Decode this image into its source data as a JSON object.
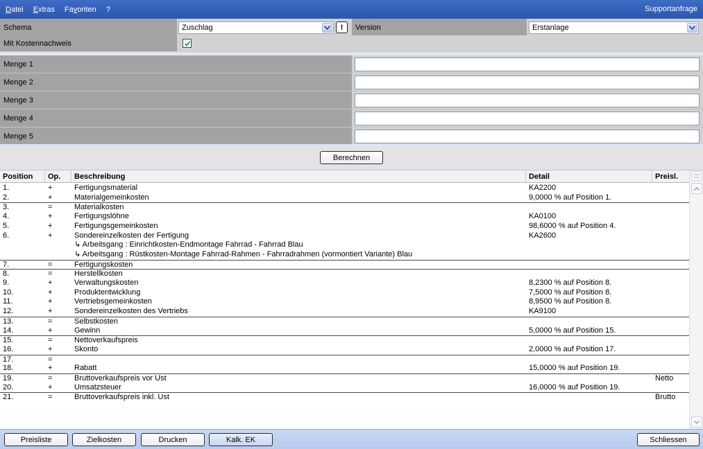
{
  "menu": {
    "items": [
      "Datei",
      "Extras",
      "Favoriten",
      "?"
    ],
    "underline": [
      "D",
      "E",
      "v",
      ""
    ],
    "support": "Supportanfrage"
  },
  "form": {
    "schema_label": "Schema",
    "schema_value": "Zuschlag",
    "warn_symbol": "!",
    "version_label": "Version",
    "version_value": "Erstanlage",
    "kostennachweis_label": "Mit Kostennachweis",
    "kostennachweis_checked": true,
    "mengen": [
      "Menge 1",
      "Menge 2",
      "Menge 3",
      "Menge 4",
      "Menge 5"
    ],
    "berechnen": "Berechnen"
  },
  "table": {
    "headers": [
      "Position",
      "Op.",
      "Beschreibung",
      "Detail",
      "Preisl."
    ],
    "rows": [
      {
        "pos": "1.",
        "op": "+",
        "desc": "Fertigungsmaterial",
        "detail": "KA2200",
        "preis": "",
        "sep": false
      },
      {
        "pos": "2.",
        "op": "+",
        "desc": "Materialgemeinkosten",
        "detail": "9,0000 % auf Position 1.",
        "preis": "",
        "sep": false
      },
      {
        "pos": "3.",
        "op": "=",
        "desc": "Materialkosten",
        "detail": "",
        "preis": "",
        "sep": true
      },
      {
        "pos": "4.",
        "op": "+",
        "desc": "Fertigungslöhne",
        "detail": "KA0100",
        "preis": "",
        "sep": false
      },
      {
        "pos": "5.",
        "op": "+",
        "desc": "Fertigungsgemeinkosten",
        "detail": "98,6000 % auf Position 4.",
        "preis": "",
        "sep": false
      },
      {
        "pos": "6.",
        "op": "+",
        "desc": "Sondereinzelkosten der Fertigung",
        "detail": "KA2600",
        "preis": "",
        "sep": false
      },
      {
        "pos": "",
        "op": "",
        "desc": "↳ Arbeitsgang : Einrichtkosten-Endmontage Fahrrad - Fahrrad Blau",
        "detail": "",
        "preis": "",
        "sep": false
      },
      {
        "pos": "",
        "op": "",
        "desc": "↳ Arbeitsgang : Rüstkosten-Montage Fahrrad-Rahmen - Fahrradrahmen (vormontiert Variante) Blau",
        "detail": "",
        "preis": "",
        "sep": false
      },
      {
        "pos": "7.",
        "op": "=",
        "desc": "Fertigungskosten",
        "detail": "",
        "preis": "",
        "sep": true
      },
      {
        "pos": "8.",
        "op": "=",
        "desc": "Herstellkosten",
        "detail": "",
        "preis": "",
        "sep": true
      },
      {
        "pos": "9.",
        "op": "+",
        "desc": "Verwaltungskosten",
        "detail": "8,2300 % auf Position 8.",
        "preis": "",
        "sep": false
      },
      {
        "pos": "10.",
        "op": "+",
        "desc": "Produktentwicklung",
        "detail": "7,5000 % auf Position 8.",
        "preis": "",
        "sep": false
      },
      {
        "pos": "11.",
        "op": "+",
        "desc": "Vertriebsgemeinkosten",
        "detail": "8,9500 % auf Position 8.",
        "preis": "",
        "sep": false
      },
      {
        "pos": "12.",
        "op": "+",
        "desc": "Sondereinzelkosten des Vertriebs",
        "detail": "KA9100",
        "preis": "",
        "sep": false
      },
      {
        "pos": "13.",
        "op": "=",
        "desc": "Selbstkosten",
        "detail": "",
        "preis": "",
        "sep": true
      },
      {
        "pos": "14.",
        "op": "+",
        "desc": "Gewinn",
        "detail": "5,0000 % auf Position 15.",
        "preis": "",
        "sep": false
      },
      {
        "pos": "15.",
        "op": "=",
        "desc": "Nettoverkaufspreis",
        "detail": "",
        "preis": "",
        "sep": true
      },
      {
        "pos": "16.",
        "op": "+",
        "desc": "Skonto",
        "detail": "2,0000 % auf Position 17.",
        "preis": "",
        "sep": false
      },
      {
        "pos": "17.",
        "op": "=",
        "desc": "",
        "detail": "",
        "preis": "",
        "sep": true
      },
      {
        "pos": "18.",
        "op": "+",
        "desc": "Rabatt",
        "detail": "15,0000 % auf Position 19.",
        "preis": "",
        "sep": false
      },
      {
        "pos": "19.",
        "op": "=",
        "desc": "Bruttoverkaufspreis vor Ust",
        "detail": "",
        "preis": "Netto",
        "sep": true
      },
      {
        "pos": "20.",
        "op": "+",
        "desc": "Umsatzsteuer",
        "detail": "16,0000 % auf Position 19.",
        "preis": "",
        "sep": false
      },
      {
        "pos": "21.",
        "op": "=",
        "desc": "Bruttoverkaufspreis inkl. Ust",
        "detail": "",
        "preis": "Brutto",
        "sep": true
      }
    ]
  },
  "footer": {
    "preisliste": "Preisliste",
    "zielkosten": "Zielkosten",
    "drucken": "Drucken",
    "kalk_ek": "Kalk. EK",
    "schliessen": "Schliessen"
  }
}
